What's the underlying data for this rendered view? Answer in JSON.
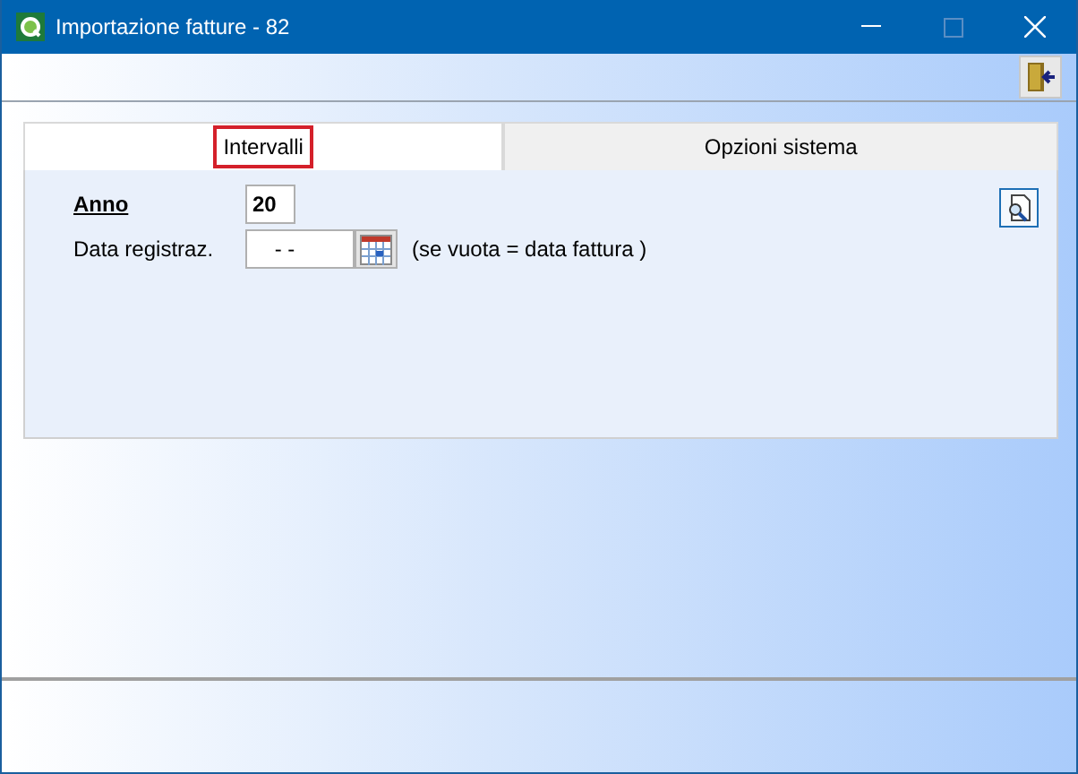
{
  "window": {
    "title": "Importazione fatture - 82"
  },
  "tabs": [
    {
      "label": "Intervalli",
      "selected": true,
      "focused": true
    },
    {
      "label": "Opzioni sistema",
      "selected": false,
      "focused": false
    }
  ],
  "fields": [
    {
      "label": "Anno",
      "kind": "text",
      "value": "20",
      "bold": true
    },
    {
      "label": "Data registraz.",
      "kind": "date",
      "value": " - -",
      "bold": false,
      "note": "(se vuota = data fattura )"
    }
  ]
}
